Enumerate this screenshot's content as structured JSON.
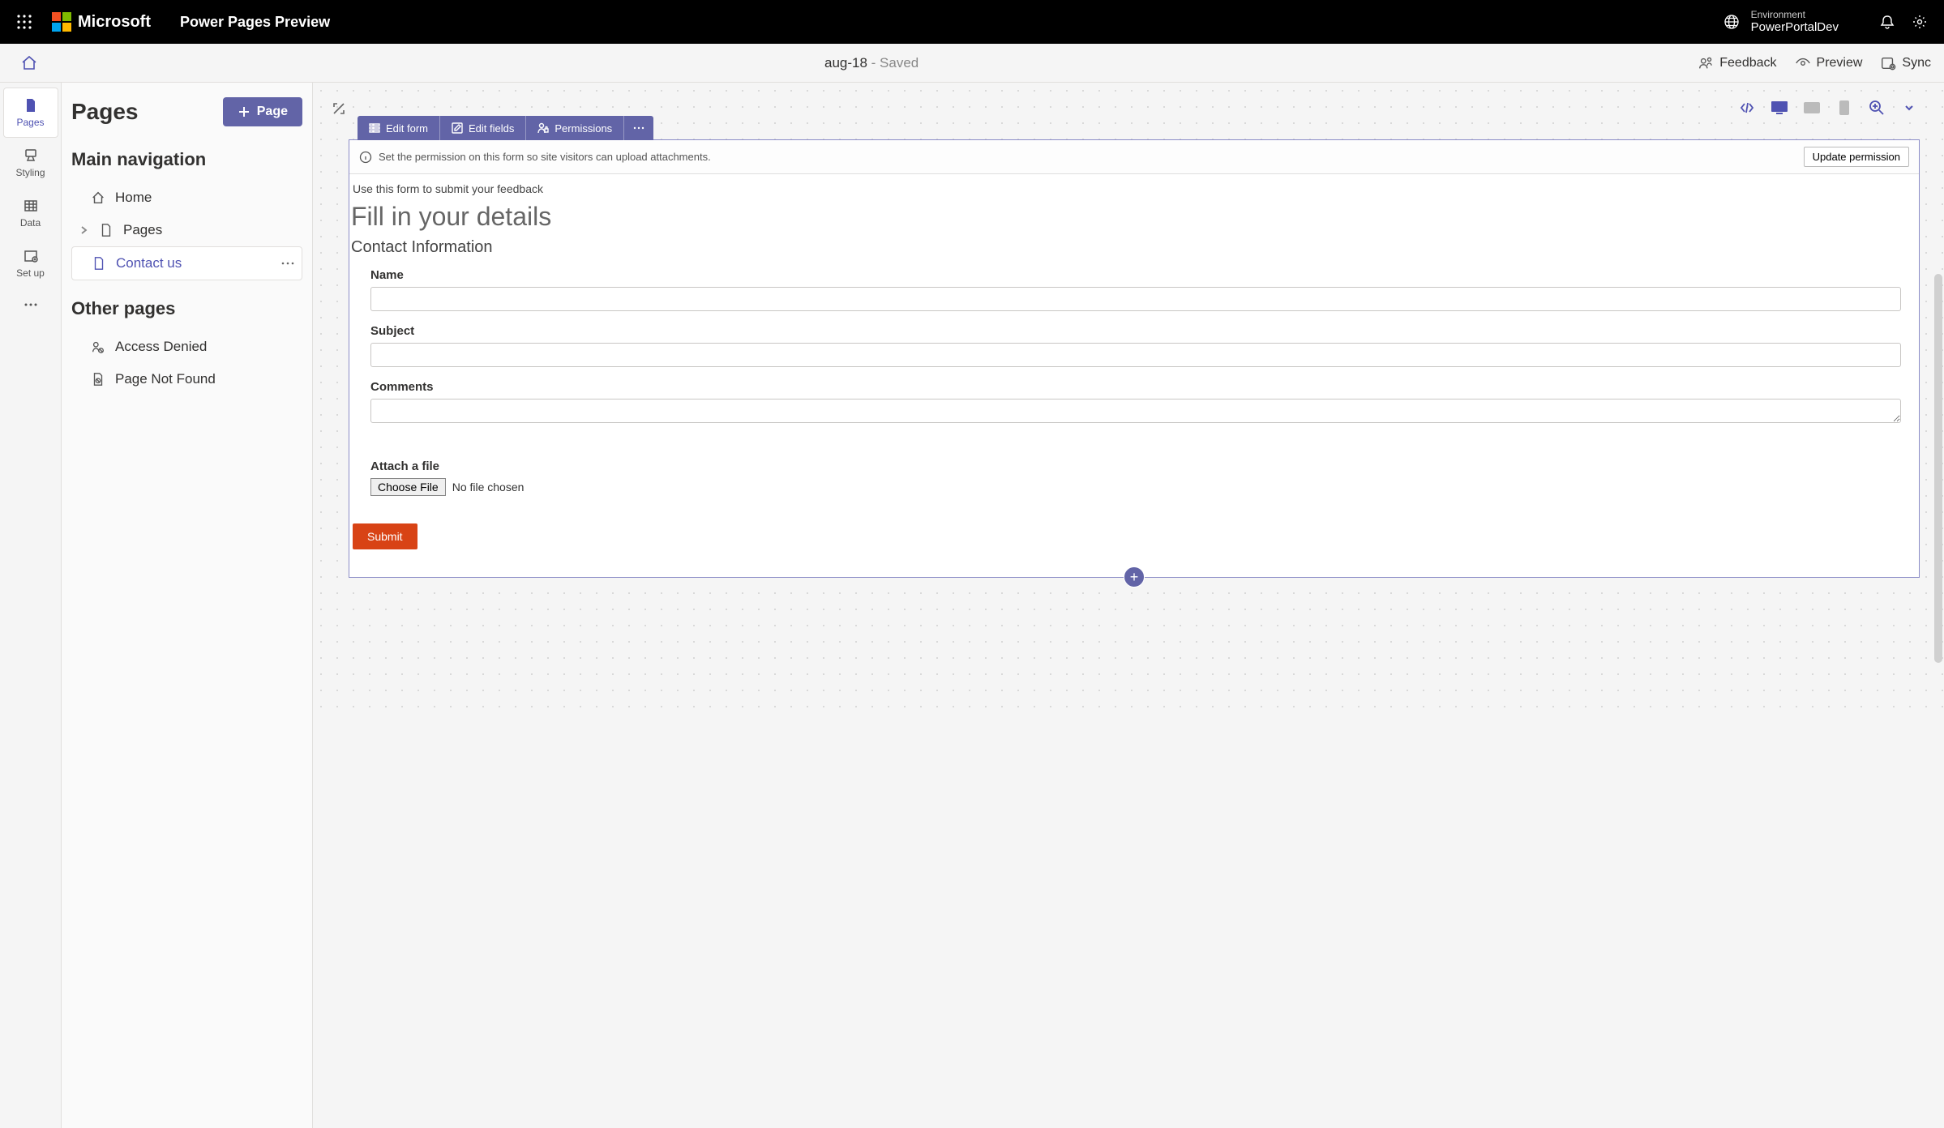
{
  "topbar": {
    "brand": "Microsoft",
    "app_title": "Power Pages Preview",
    "env_label": "Environment",
    "env_name": "PowerPortalDev"
  },
  "cmdbar": {
    "site_name": "aug-18",
    "status": " - Saved",
    "feedback": "Feedback",
    "preview": "Preview",
    "sync": "Sync"
  },
  "rail": {
    "pages": "Pages",
    "styling": "Styling",
    "data": "Data",
    "setup": "Set up"
  },
  "panel": {
    "title": "Pages",
    "add_button": "Page",
    "section_main": "Main navigation",
    "item_home": "Home",
    "item_pages": "Pages",
    "item_contact": "Contact us",
    "section_other": "Other pages",
    "item_access_denied": "Access Denied",
    "item_not_found": "Page Not Found"
  },
  "form_toolbar": {
    "edit_form": "Edit form",
    "edit_fields": "Edit fields",
    "permissions": "Permissions"
  },
  "notice": {
    "text": "Set the permission on this form so site visitors can upload attachments.",
    "button": "Update permission"
  },
  "form": {
    "intro": "Use this form to submit your feedback",
    "heading": "Fill in your details",
    "section": "Contact Information",
    "label_name": "Name",
    "label_subject": "Subject",
    "label_comments": "Comments",
    "label_attach": "Attach a file",
    "choose_file": "Choose File",
    "no_file": "No file chosen",
    "submit": "Submit"
  }
}
